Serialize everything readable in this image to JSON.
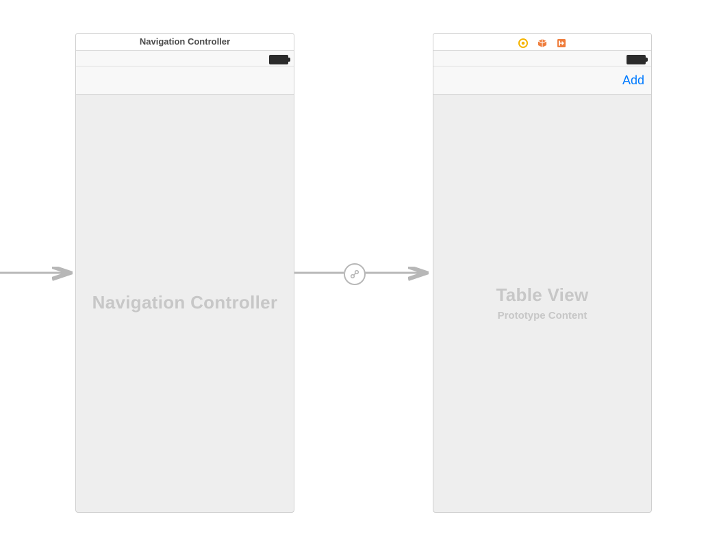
{
  "sceneA": {
    "title": "Navigation Controller",
    "placeholder": "Navigation Controller"
  },
  "sceneB": {
    "add_label": "Add",
    "placeholder_title": "Table View",
    "placeholder_subtitle": "Prototype Content"
  },
  "colors": {
    "tint": "#007aff",
    "arrow": "#b7b7b7",
    "identity_icon": "#f5b400",
    "class_icon": "#ef7d3c",
    "segue_icon": "#ef7d3c"
  }
}
